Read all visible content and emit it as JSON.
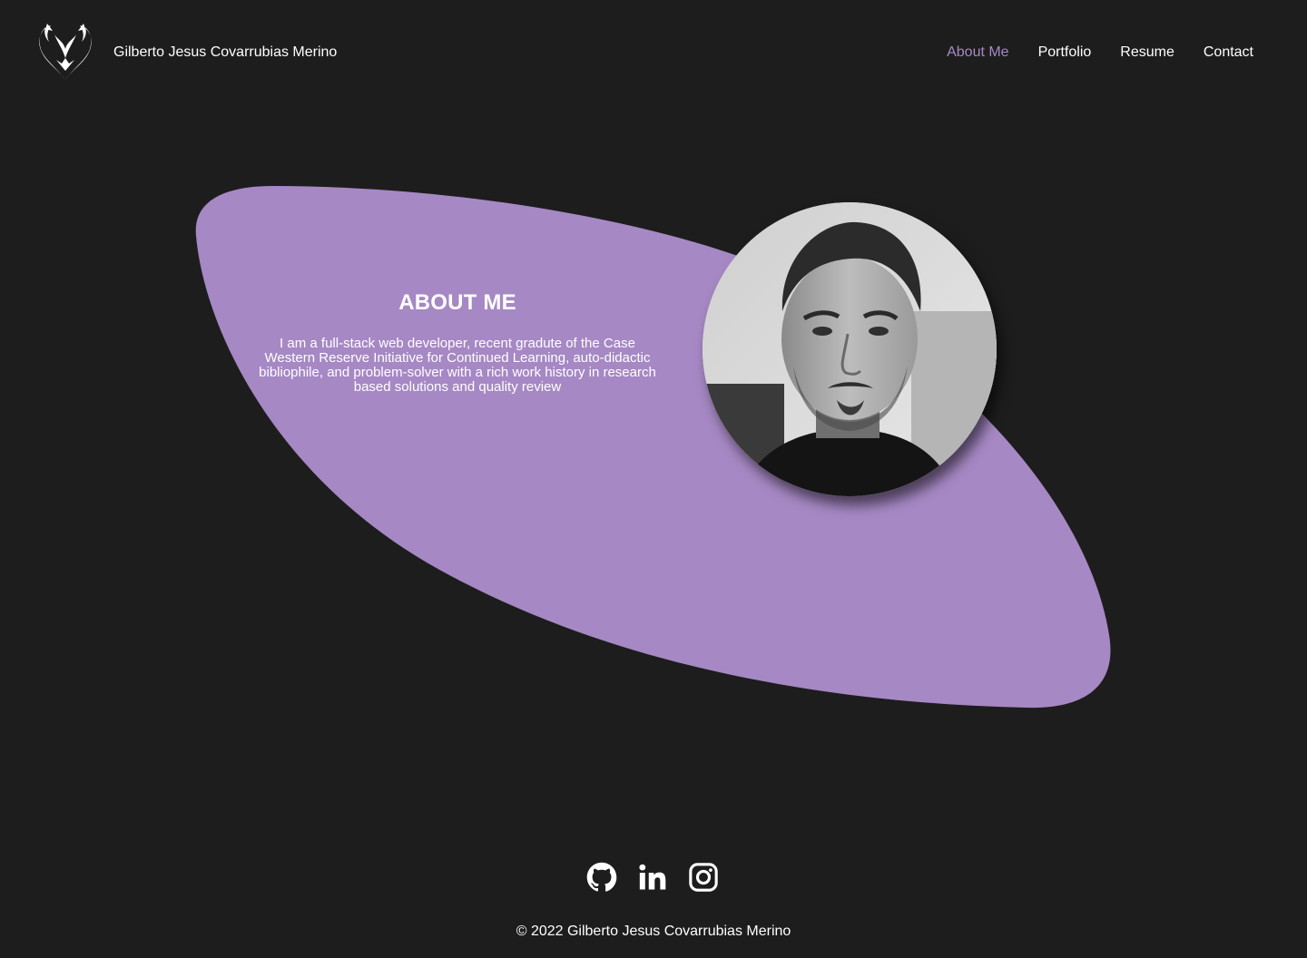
{
  "header": {
    "site_name": "Gilberto Jesus Covarrubias Merino",
    "logo_icon": "tribal-heart-logo-icon"
  },
  "nav": {
    "items": [
      {
        "label": "About Me",
        "active": true
      },
      {
        "label": "Portfolio",
        "active": false
      },
      {
        "label": "Resume",
        "active": false
      },
      {
        "label": "Contact",
        "active": false
      }
    ]
  },
  "about": {
    "title": "ABOUT ME",
    "text": "I am a full-stack web developer, recent gradute of the Case Western Reserve Initiative for Continued Learning, auto-didactic bibliophile, and problem-solver with a rich work history in research based solutions and quality review"
  },
  "footer": {
    "socials": [
      {
        "icon": "github-icon"
      },
      {
        "icon": "linkedin-icon"
      },
      {
        "icon": "instagram-icon"
      }
    ],
    "copyright": "© 2022 Gilberto Jesus Covarrubias Merino"
  },
  "colors": {
    "background": "#1d1d1d",
    "accent": "#a688c4",
    "text": "#ffffff"
  }
}
